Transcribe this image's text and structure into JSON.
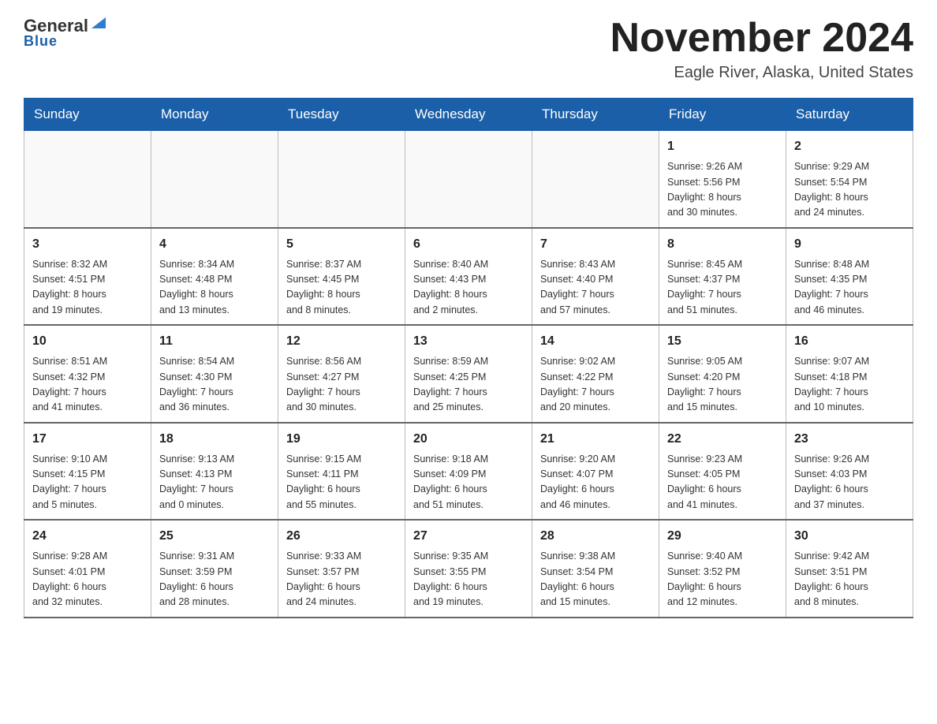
{
  "header": {
    "logo_main": "General",
    "logo_blue": "Blue",
    "month_title": "November 2024",
    "location": "Eagle River, Alaska, United States"
  },
  "days_of_week": [
    "Sunday",
    "Monday",
    "Tuesday",
    "Wednesday",
    "Thursday",
    "Friday",
    "Saturday"
  ],
  "weeks": [
    [
      {
        "day": "",
        "info": ""
      },
      {
        "day": "",
        "info": ""
      },
      {
        "day": "",
        "info": ""
      },
      {
        "day": "",
        "info": ""
      },
      {
        "day": "",
        "info": ""
      },
      {
        "day": "1",
        "info": "Sunrise: 9:26 AM\nSunset: 5:56 PM\nDaylight: 8 hours\nand 30 minutes."
      },
      {
        "day": "2",
        "info": "Sunrise: 9:29 AM\nSunset: 5:54 PM\nDaylight: 8 hours\nand 24 minutes."
      }
    ],
    [
      {
        "day": "3",
        "info": "Sunrise: 8:32 AM\nSunset: 4:51 PM\nDaylight: 8 hours\nand 19 minutes."
      },
      {
        "day": "4",
        "info": "Sunrise: 8:34 AM\nSunset: 4:48 PM\nDaylight: 8 hours\nand 13 minutes."
      },
      {
        "day": "5",
        "info": "Sunrise: 8:37 AM\nSunset: 4:45 PM\nDaylight: 8 hours\nand 8 minutes."
      },
      {
        "day": "6",
        "info": "Sunrise: 8:40 AM\nSunset: 4:43 PM\nDaylight: 8 hours\nand 2 minutes."
      },
      {
        "day": "7",
        "info": "Sunrise: 8:43 AM\nSunset: 4:40 PM\nDaylight: 7 hours\nand 57 minutes."
      },
      {
        "day": "8",
        "info": "Sunrise: 8:45 AM\nSunset: 4:37 PM\nDaylight: 7 hours\nand 51 minutes."
      },
      {
        "day": "9",
        "info": "Sunrise: 8:48 AM\nSunset: 4:35 PM\nDaylight: 7 hours\nand 46 minutes."
      }
    ],
    [
      {
        "day": "10",
        "info": "Sunrise: 8:51 AM\nSunset: 4:32 PM\nDaylight: 7 hours\nand 41 minutes."
      },
      {
        "day": "11",
        "info": "Sunrise: 8:54 AM\nSunset: 4:30 PM\nDaylight: 7 hours\nand 36 minutes."
      },
      {
        "day": "12",
        "info": "Sunrise: 8:56 AM\nSunset: 4:27 PM\nDaylight: 7 hours\nand 30 minutes."
      },
      {
        "day": "13",
        "info": "Sunrise: 8:59 AM\nSunset: 4:25 PM\nDaylight: 7 hours\nand 25 minutes."
      },
      {
        "day": "14",
        "info": "Sunrise: 9:02 AM\nSunset: 4:22 PM\nDaylight: 7 hours\nand 20 minutes."
      },
      {
        "day": "15",
        "info": "Sunrise: 9:05 AM\nSunset: 4:20 PM\nDaylight: 7 hours\nand 15 minutes."
      },
      {
        "day": "16",
        "info": "Sunrise: 9:07 AM\nSunset: 4:18 PM\nDaylight: 7 hours\nand 10 minutes."
      }
    ],
    [
      {
        "day": "17",
        "info": "Sunrise: 9:10 AM\nSunset: 4:15 PM\nDaylight: 7 hours\nand 5 minutes."
      },
      {
        "day": "18",
        "info": "Sunrise: 9:13 AM\nSunset: 4:13 PM\nDaylight: 7 hours\nand 0 minutes."
      },
      {
        "day": "19",
        "info": "Sunrise: 9:15 AM\nSunset: 4:11 PM\nDaylight: 6 hours\nand 55 minutes."
      },
      {
        "day": "20",
        "info": "Sunrise: 9:18 AM\nSunset: 4:09 PM\nDaylight: 6 hours\nand 51 minutes."
      },
      {
        "day": "21",
        "info": "Sunrise: 9:20 AM\nSunset: 4:07 PM\nDaylight: 6 hours\nand 46 minutes."
      },
      {
        "day": "22",
        "info": "Sunrise: 9:23 AM\nSunset: 4:05 PM\nDaylight: 6 hours\nand 41 minutes."
      },
      {
        "day": "23",
        "info": "Sunrise: 9:26 AM\nSunset: 4:03 PM\nDaylight: 6 hours\nand 37 minutes."
      }
    ],
    [
      {
        "day": "24",
        "info": "Sunrise: 9:28 AM\nSunset: 4:01 PM\nDaylight: 6 hours\nand 32 minutes."
      },
      {
        "day": "25",
        "info": "Sunrise: 9:31 AM\nSunset: 3:59 PM\nDaylight: 6 hours\nand 28 minutes."
      },
      {
        "day": "26",
        "info": "Sunrise: 9:33 AM\nSunset: 3:57 PM\nDaylight: 6 hours\nand 24 minutes."
      },
      {
        "day": "27",
        "info": "Sunrise: 9:35 AM\nSunset: 3:55 PM\nDaylight: 6 hours\nand 19 minutes."
      },
      {
        "day": "28",
        "info": "Sunrise: 9:38 AM\nSunset: 3:54 PM\nDaylight: 6 hours\nand 15 minutes."
      },
      {
        "day": "29",
        "info": "Sunrise: 9:40 AM\nSunset: 3:52 PM\nDaylight: 6 hours\nand 12 minutes."
      },
      {
        "day": "30",
        "info": "Sunrise: 9:42 AM\nSunset: 3:51 PM\nDaylight: 6 hours\nand 8 minutes."
      }
    ]
  ]
}
